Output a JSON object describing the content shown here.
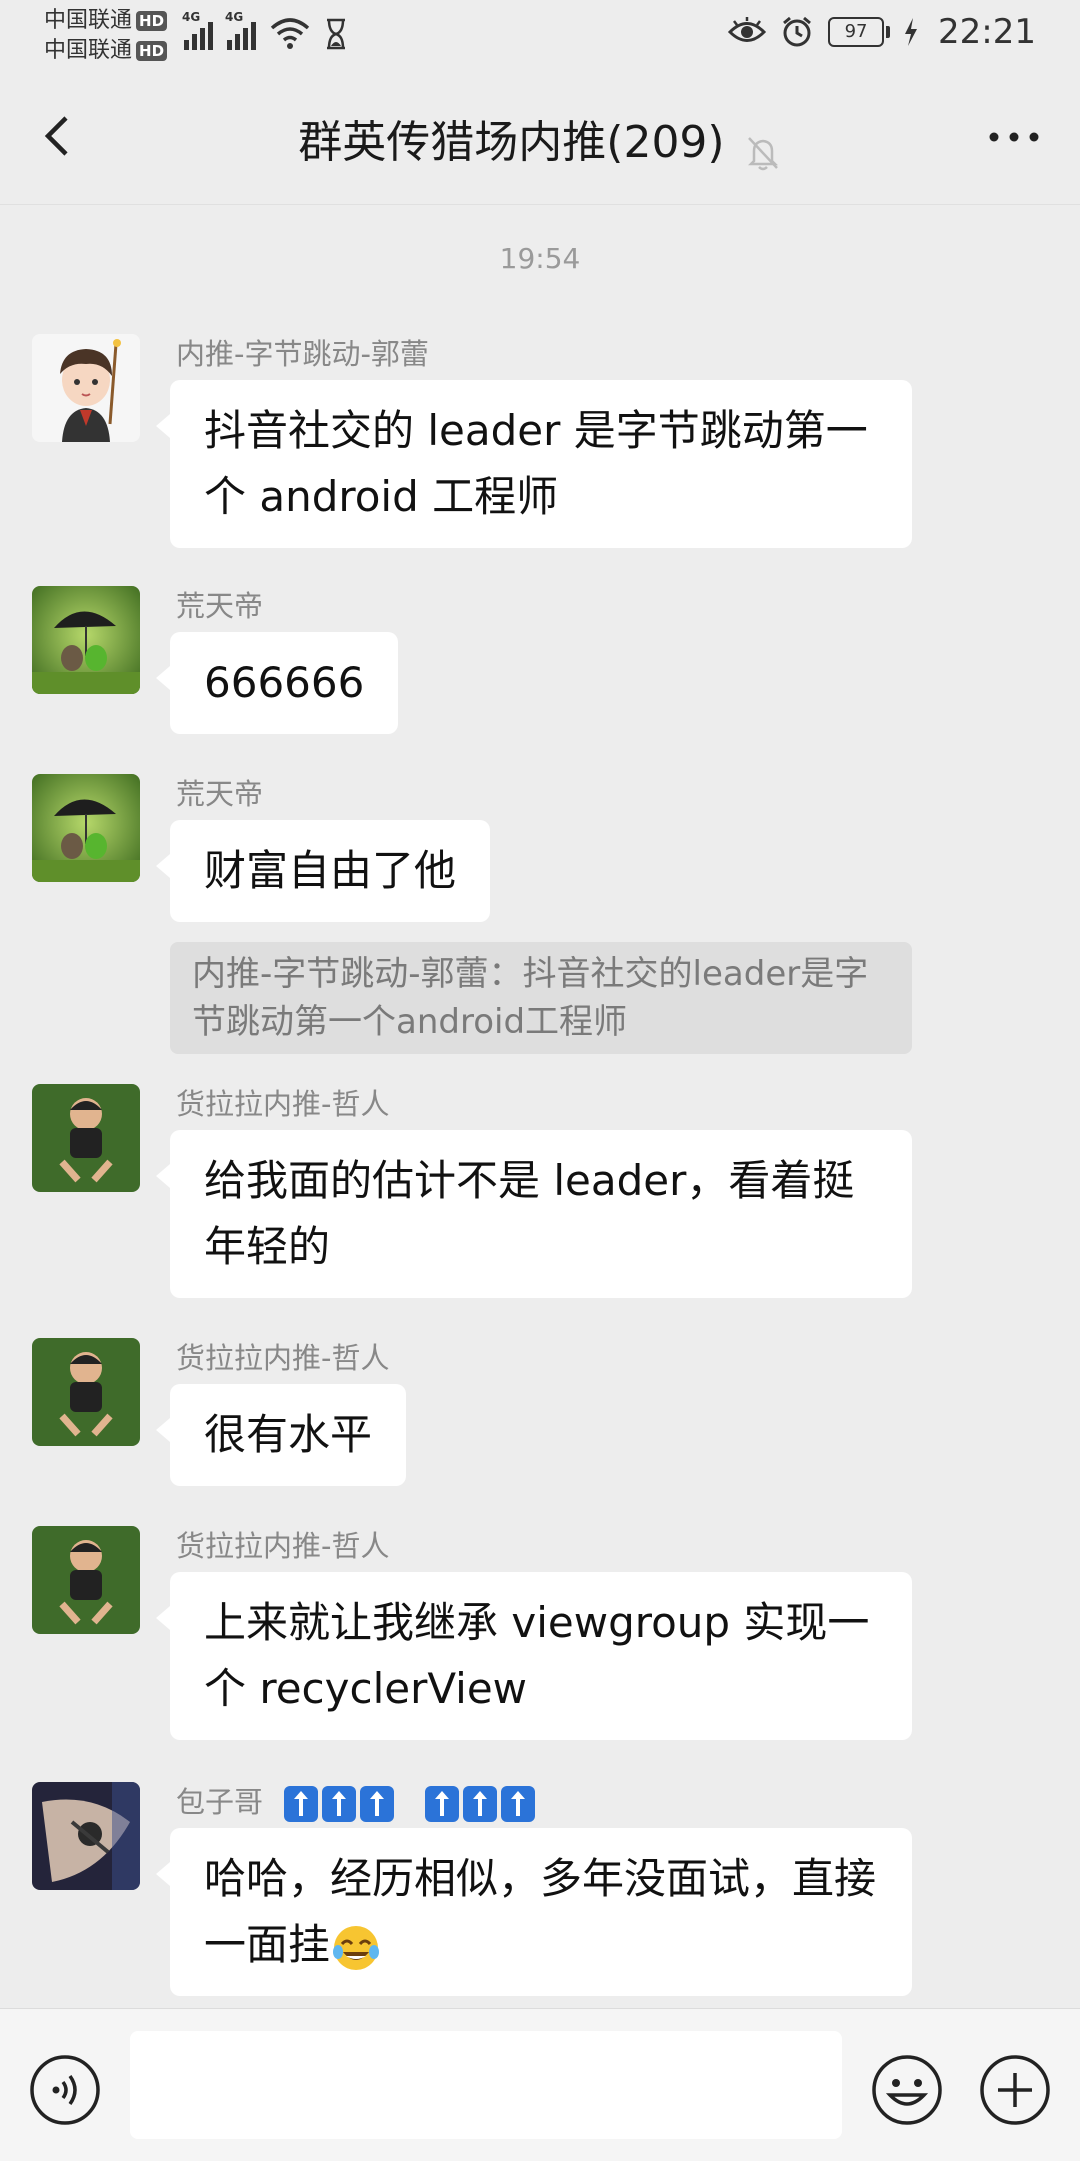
{
  "status_bar": {
    "carrier_1": "中国联通",
    "carrier_2": "中国联通",
    "hd_label": "HD",
    "network_1": "4G",
    "network_2": "4G",
    "battery_level": "97",
    "time": "22:21",
    "icons": [
      "eye-icon",
      "alarm-icon",
      "battery-icon",
      "charging-icon",
      "wifi-icon",
      "hourglass-icon",
      "signal-icon"
    ]
  },
  "title_bar": {
    "title": "群英传猎场内推(209)",
    "icons": [
      "back-icon",
      "mute-bell-icon",
      "more-icon"
    ]
  },
  "chat": {
    "timestamp": "19:54",
    "messages": [
      {
        "sender": "内推-字节跳动-郭蕾",
        "text": "抖音社交的 leader 是字节跳动第一个 android 工程师"
      },
      {
        "sender": "荒天帝",
        "text": "666666"
      },
      {
        "sender": "荒天帝",
        "text": "财富自由了他",
        "quote": "内推-字节跳动-郭蕾：抖音社交的leader是字节跳动第一个android工程师"
      },
      {
        "sender": "货拉拉内推-哲人",
        "text": "给我面的估计不是 leader，看着挺年轻的"
      },
      {
        "sender": "货拉拉内推-哲人",
        "text": "很有水平"
      },
      {
        "sender": "货拉拉内推-哲人",
        "text": "上来就让我继承 viewgroup 实现一个 recyclerView"
      },
      {
        "sender": "包子哥",
        "sender_badges": 6,
        "text": "哈哈，经历相似，多年没面试，直接一面挂",
        "emoji": "tears-of-joy-emoji"
      }
    ]
  },
  "input_bar": {
    "value": "",
    "icons": [
      "voice-icon",
      "emoji-icon",
      "plus-icon"
    ]
  },
  "colors": {
    "background": "#ededed",
    "bubble": "#ffffff",
    "quote_bg": "#dedede",
    "sender_text": "#888888",
    "badge_blue": "#2b73d8"
  }
}
